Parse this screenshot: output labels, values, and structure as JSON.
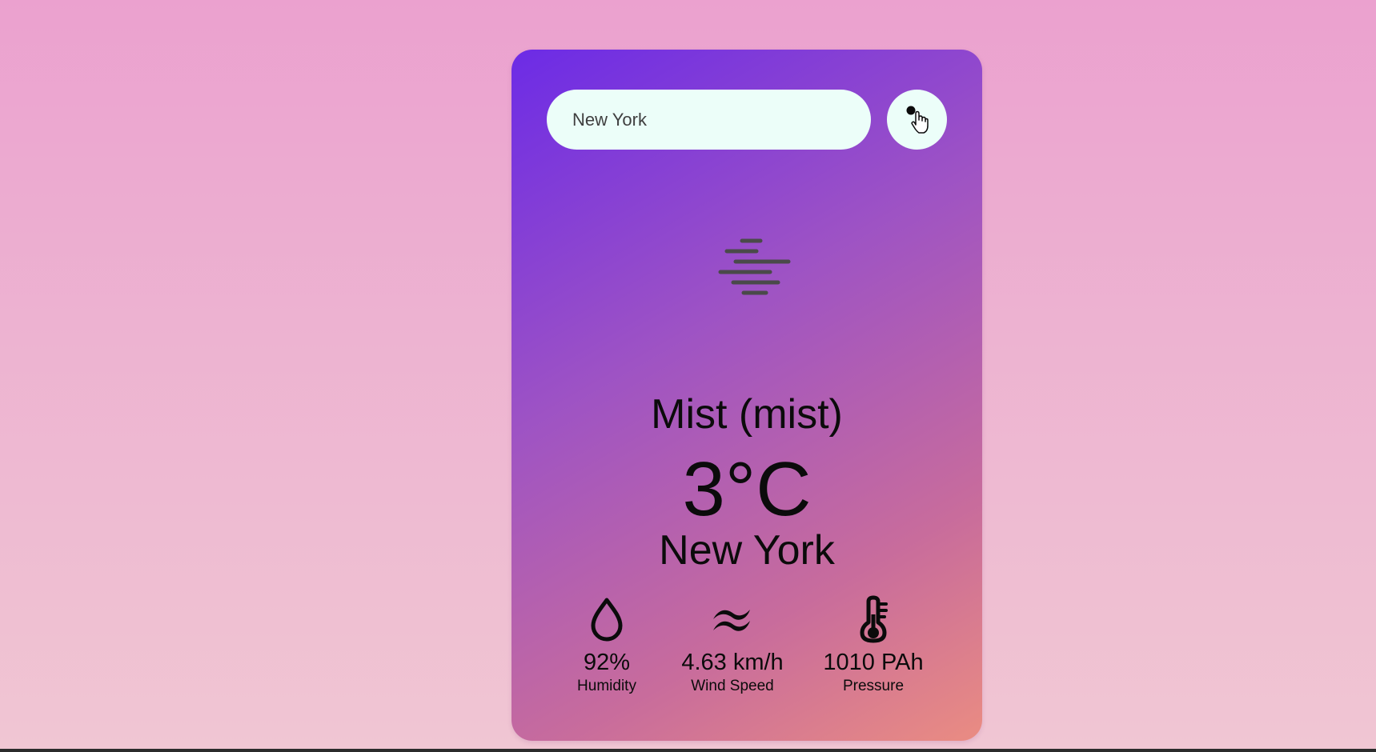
{
  "search": {
    "value": "New York"
  },
  "weather": {
    "icon": "mist-icon",
    "description": "Mist (mist)",
    "temperature": "3°C",
    "city": "New York"
  },
  "details": [
    {
      "icon": "water-drop-icon",
      "value": "92%",
      "label": "Humidity"
    },
    {
      "icon": "wind-icon",
      "value": "4.63 km/h",
      "label": "Wind Speed"
    },
    {
      "icon": "thermometer-icon",
      "value": "1010 PAh",
      "label": "Pressure"
    }
  ],
  "colors": {
    "page_background": "#eda9d0",
    "card_gradient_start": "#6c2be6",
    "card_gradient_end": "#ea8c82",
    "input_background": "#ecfef9",
    "text": "#0b0b0b"
  }
}
